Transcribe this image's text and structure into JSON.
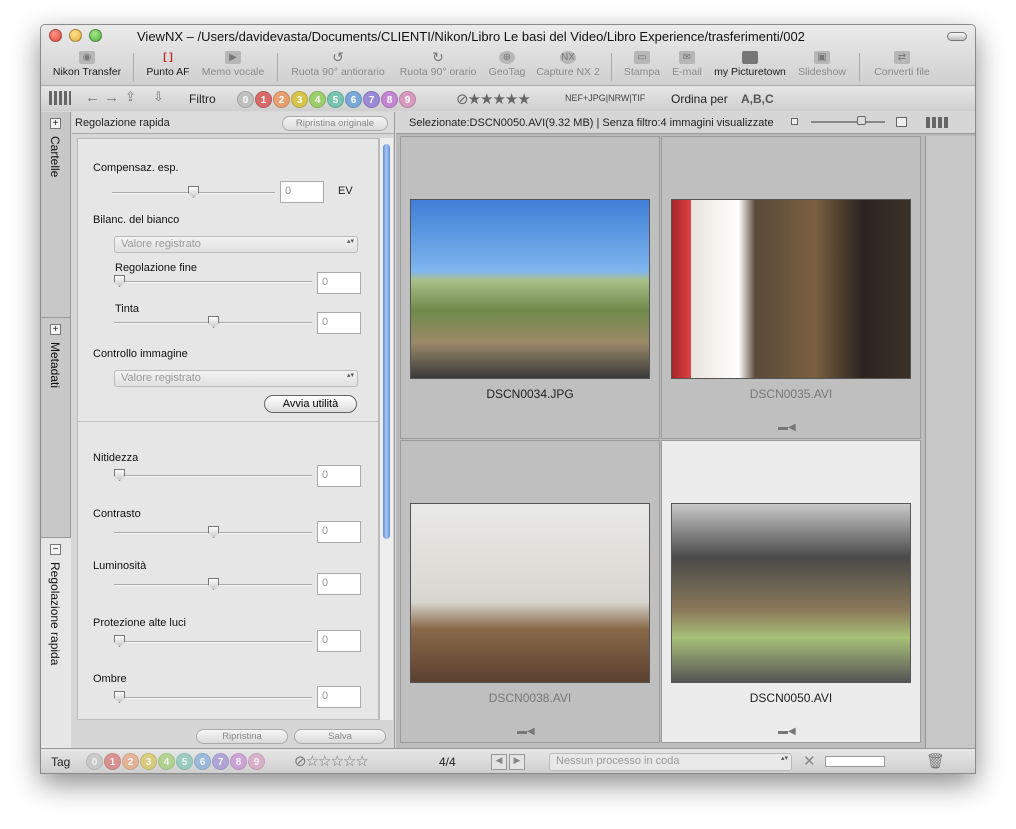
{
  "window": {
    "title": "ViewNX – /Users/davidevasta/Documents/CLIENTI/Nikon/Libro Le basi del Video/Libro Experience/trasferimenti/002"
  },
  "toolbar": [
    {
      "label": "Nikon Transfer",
      "icon": "camera-icon",
      "disabled": false
    },
    {
      "label": "Punto AF",
      "icon": "af-point-icon",
      "disabled": false
    },
    {
      "label": "Memo vocale",
      "icon": "voice-memo-icon",
      "disabled": true
    },
    {
      "label": "Ruota 90° antiorario",
      "icon": "rotate-ccw-icon",
      "disabled": true
    },
    {
      "label": "Ruota 90° orario",
      "icon": "rotate-cw-icon",
      "disabled": true
    },
    {
      "label": "GeoTag",
      "icon": "geotag-icon",
      "disabled": true
    },
    {
      "label": "Capture NX 2",
      "icon": "capture-nx-icon",
      "disabled": true
    },
    {
      "label": "Stampa",
      "icon": "print-icon",
      "disabled": true
    },
    {
      "label": "E-mail",
      "icon": "email-icon",
      "disabled": true
    },
    {
      "label": "my Picturetown",
      "icon": "picturetown-icon",
      "disabled": false
    },
    {
      "label": "Slideshow",
      "icon": "slideshow-icon",
      "disabled": true
    },
    {
      "label": "Converti file",
      "icon": "convert-icon",
      "disabled": true
    }
  ],
  "filterbar": {
    "filter_label": "Filtro",
    "numbers": [
      "0",
      "1",
      "2",
      "3",
      "4",
      "5",
      "6",
      "7",
      "8",
      "9"
    ],
    "number_colors": [
      "#c0c0c0",
      "#d86a6a",
      "#e8a070",
      "#d6c44c",
      "#9ccf6a",
      "#78c6b0",
      "#7aa8d8",
      "#9a8ad8",
      "#c486d2",
      "#d89ac0"
    ],
    "rating": "⊘★★★★★",
    "format": "NEF+JPG|NRW|TIF",
    "sort_label": "Ordina per",
    "sort_value": "A,B,C"
  },
  "tabs": [
    {
      "label": "Cartelle"
    },
    {
      "label": "Metadati"
    },
    {
      "label": "Regolazione rapida"
    }
  ],
  "panel": {
    "title": "Regolazione rapida",
    "restore_button": "Ripristina originale",
    "exposure": {
      "label": "Compensaz. esp.",
      "value": "0",
      "unit": "EV",
      "level": 0.5
    },
    "wb": {
      "label": "Bilanc. del bianco",
      "select": "Valore registrato"
    },
    "fine": {
      "label": "Regolazione fine",
      "value": "0",
      "level": 0
    },
    "tint": {
      "label": "Tinta",
      "value": "0",
      "level": 0.5
    },
    "image_control": {
      "label": "Controllo immagine",
      "select": "Valore registrato",
      "button": "Avvia utilità"
    },
    "sharpness": {
      "label": "Nitidezza",
      "value": "0",
      "level": 0
    },
    "contrast": {
      "label": "Contrasto",
      "value": "0",
      "level": 0.5
    },
    "brightness": {
      "label": "Luminosità",
      "value": "0",
      "level": 0.5
    },
    "highlights": {
      "label": "Protezione alte luci",
      "value": "0",
      "level": 0
    },
    "shadows": {
      "label": "Ombre",
      "value": "0",
      "level": 0
    },
    "reset_button": "Ripristina",
    "save_button": "Salva"
  },
  "content": {
    "header": "Selezionate:DSCN0050.AVI(9.32 MB) | Senza filtro:4 immagini visualizzate",
    "items": [
      {
        "name": "DSCN0034.JPG",
        "movie": false,
        "dim": false,
        "selected": false
      },
      {
        "name": "DSCN0035.AVI",
        "movie": true,
        "dim": true,
        "selected": false
      },
      {
        "name": "DSCN0038.AVI",
        "movie": true,
        "dim": true,
        "selected": false
      },
      {
        "name": "DSCN0050.AVI",
        "movie": true,
        "dim": false,
        "selected": true
      }
    ]
  },
  "status": {
    "tag_label": "Tag",
    "stars": "⊘☆☆☆☆☆",
    "page": "4/4",
    "queue": "Nessun processo in coda"
  }
}
